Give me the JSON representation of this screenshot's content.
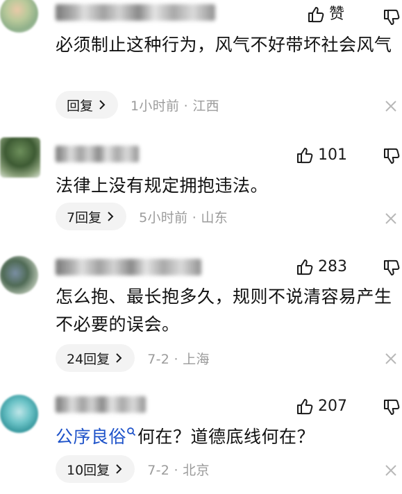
{
  "comments": [
    {
      "likes": "赞",
      "text": "必须制止这种行为，风气不好带坏社会风气",
      "reply_label": "回复",
      "meta": "1小时前 · 江西"
    },
    {
      "likes": "101",
      "text": "法律上没有规定拥抱违法。",
      "reply_label": "7回复",
      "meta": "5小时前 · 山东"
    },
    {
      "likes": "283",
      "text": "怎么抱、最长抱多久，规则不说清容易产生不必要的误会。",
      "reply_label": "24回复",
      "meta": "7-2 · 上海"
    },
    {
      "likes": "207",
      "topic": "公序良俗",
      "text": "何在？道德底线何在？",
      "reply_label": "10回复",
      "meta": "7-2 · 北京"
    }
  ],
  "icons": {
    "like": "thumbs-up-icon",
    "dislike": "thumbs-down-icon",
    "chevron": "chevron-right-icon",
    "close": "close-icon",
    "search": "search-icon"
  },
  "colors": {
    "topic_link": "#1d52c9",
    "meta_gray": "#9b9b9b",
    "chip_bg": "#f3f3f3"
  }
}
